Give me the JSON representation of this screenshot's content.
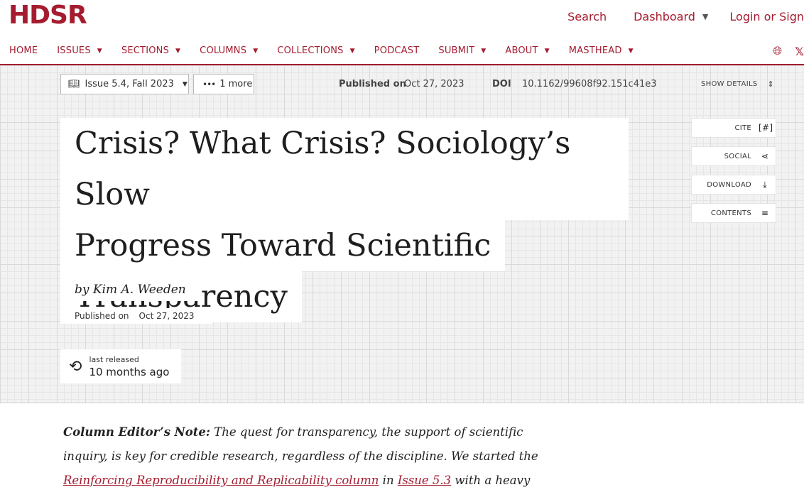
{
  "brand": {
    "logo_text": "HDSR"
  },
  "top_links": {
    "search": "Search",
    "dashboard": "Dashboard",
    "login": "Login or Sign"
  },
  "nav": {
    "items": [
      {
        "label": "HOME",
        "has_menu": false
      },
      {
        "label": "ISSUES",
        "has_menu": true
      },
      {
        "label": "SECTIONS",
        "has_menu": true
      },
      {
        "label": "COLUMNS",
        "has_menu": true
      },
      {
        "label": "COLLECTIONS",
        "has_menu": true
      },
      {
        "label": "PODCAST",
        "has_menu": false
      },
      {
        "label": "SUBMIT",
        "has_menu": true
      },
      {
        "label": "ABOUT",
        "has_menu": true
      },
      {
        "label": "MASTHEAD",
        "has_menu": true
      }
    ],
    "icons": [
      "globe-icon",
      "x-twitter-icon"
    ]
  },
  "meta": {
    "issue": "Issue 5.4, Fall 2023",
    "more": "1 more",
    "published_label": "Published on",
    "published_date": "Oct 27, 2023",
    "doi_label": "DOI",
    "doi_value": "10.1162/99608f92.151c41e3",
    "show_details": "SHOW DETAILS"
  },
  "article": {
    "title_lines": [
      "Crisis? What Crisis? Sociology’s Slow",
      "Progress Toward Scientific",
      "Transparency"
    ],
    "byline": "by Kim A. Weeden",
    "published_label": "Published on",
    "published_date": "Oct 27, 2023",
    "release_label": "last released",
    "release_value": "10 months ago"
  },
  "side_actions": [
    {
      "label": "CITE",
      "icon": "cite-icon",
      "glyph": "[#]"
    },
    {
      "label": "SOCIAL",
      "icon": "share-icon",
      "glyph": "⋖"
    },
    {
      "label": "DOWNLOAD",
      "icon": "download-icon",
      "glyph": "⤓"
    },
    {
      "label": "CONTENTS",
      "icon": "contents-icon",
      "glyph": "≡"
    }
  ],
  "body": {
    "note_label": "Column Editor’s Note:",
    "text_1": " The quest for transparency, the support of scientific inquiry, is key for credible research, regardless of the discipline. We started the ",
    "link_1": "Reinforcing Reproducibility and Replicability column",
    "text_2": " in ",
    "link_2": "Issue 5.3",
    "text_3": " with a heavy focus on"
  },
  "colors": {
    "accent": "#a51c30"
  }
}
